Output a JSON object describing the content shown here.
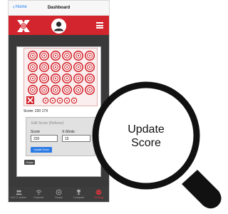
{
  "status_bar": {
    "back_label": "Home",
    "title": "Dashboard"
  },
  "header": {
    "logo_icon": "x-target-logo",
    "avatar_icon": "user-avatar-icon",
    "menu_icon": "hamburger-menu-icon",
    "brand_color": "#d2252d"
  },
  "score_summary": "Score: 220 17X",
  "edit_score": {
    "title": "Edit Score (Referee)",
    "score_label": "Score",
    "xshots_label": "X-Shots",
    "score_value": "220",
    "xshots_value": "15",
    "update_button": "Update Score"
  },
  "close_button": "Close",
  "tabs": [
    {
      "label": "B.E.V. Active",
      "icon": "users-icon",
      "active": false
    },
    {
      "label": "Channel",
      "icon": "wifi-icon",
      "active": false
    },
    {
      "label": "Scope",
      "icon": "scope-icon",
      "active": false
    },
    {
      "label": "Compete",
      "icon": "trophy-icon",
      "active": false
    },
    {
      "label": "Settings",
      "icon": "gear-icon",
      "active": true
    }
  ],
  "callout": {
    "line1": "Update",
    "line2": "Score"
  },
  "accent_color": "#2c7be5"
}
